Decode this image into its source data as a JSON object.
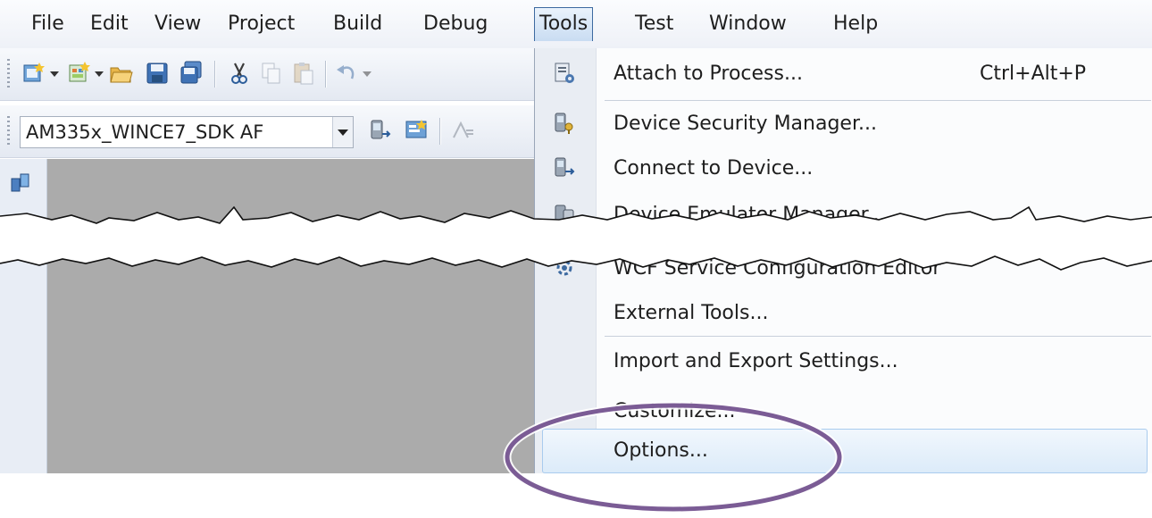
{
  "menubar": {
    "items": [
      {
        "label": "File"
      },
      {
        "label": "Edit"
      },
      {
        "label": "View"
      },
      {
        "label": "Project"
      },
      {
        "label": "Build"
      },
      {
        "label": "Debug"
      },
      {
        "label": "Tools",
        "active": true
      },
      {
        "label": "Test"
      },
      {
        "label": "Window"
      },
      {
        "label": "Help"
      }
    ]
  },
  "standard_toolbar": {
    "buttons": [
      "new-project-icon",
      "add-item-icon",
      "open-folder-icon",
      "save-icon",
      "save-all-icon",
      "cut-icon",
      "copy-icon",
      "paste-icon",
      "undo-icon"
    ]
  },
  "device_toolbar": {
    "target_device_value": "AM335x_WINCE7_SDK AF",
    "buttons": [
      "connect-device-icon",
      "device-properties-icon",
      "format-icon"
    ]
  },
  "tools_menu": {
    "items": [
      {
        "label": "Attach to Process...",
        "shortcut": "Ctrl+Alt+P",
        "icon": "attach-process-icon"
      },
      {
        "label": "Device Security Manager...",
        "icon": "device-security-icon"
      },
      {
        "label": "Connect to Device...",
        "icon": "connect-device-icon"
      },
      {
        "label": "Device Emulator Manager...",
        "icon": "device-emulator-icon"
      },
      {
        "label": "WCF Service Configuration Editor",
        "icon": "wcf-config-icon"
      },
      {
        "label": "External Tools..."
      },
      {
        "label": "Import and Export Settings..."
      },
      {
        "label": "Customize..."
      },
      {
        "label": "Options...",
        "highlighted": true
      }
    ]
  },
  "colors": {
    "highlight_ring": "#7b5c95",
    "menu_active_border": "#3d6aa0",
    "workspace": "#ababab"
  }
}
